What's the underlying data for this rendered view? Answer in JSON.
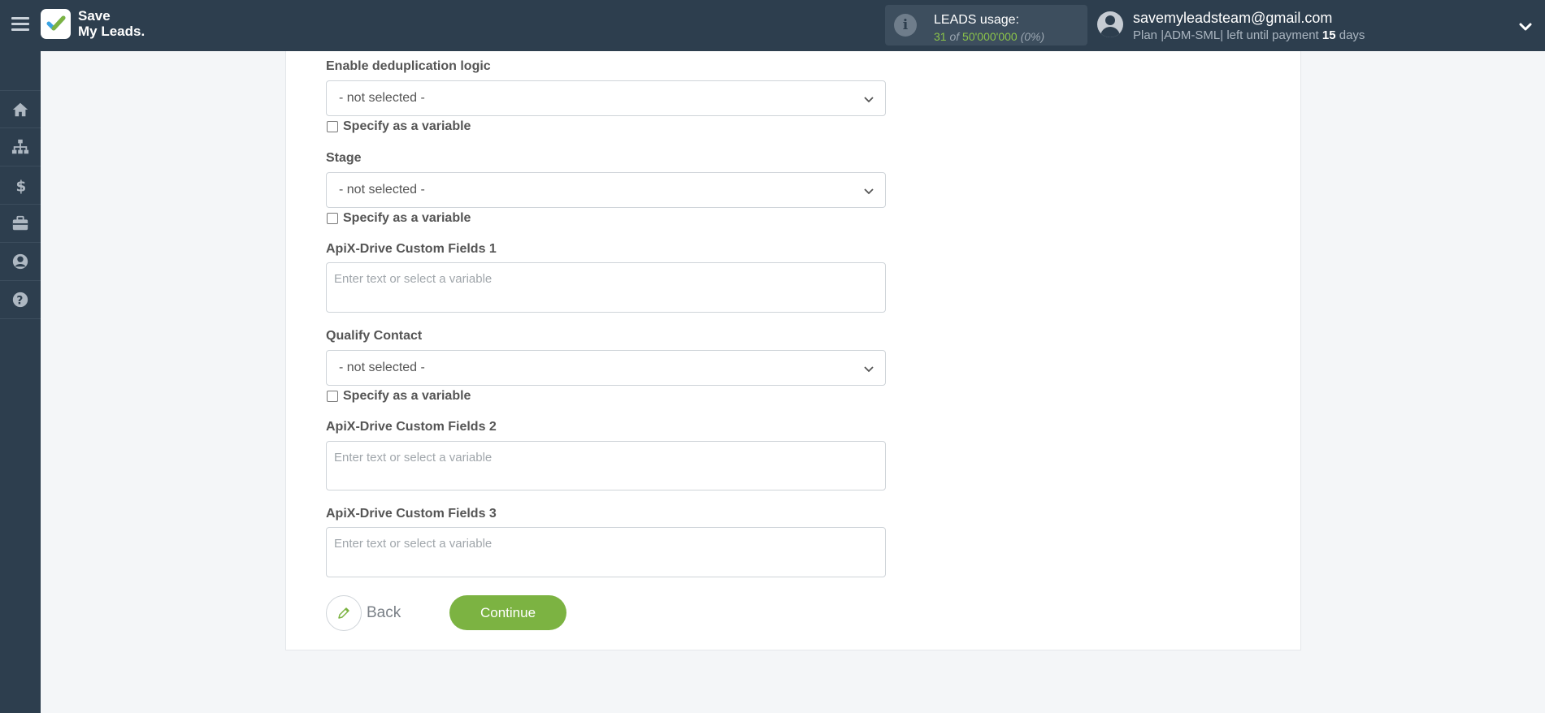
{
  "brand": {
    "line1": "Save",
    "line2": "My Leads",
    "dot": "."
  },
  "usage": {
    "title": "LEADS usage:",
    "used": "31",
    "of": "of",
    "limit": "50'000'000",
    "percent": "(0%)"
  },
  "account": {
    "email": "savemyleadsteam@gmail.com",
    "plan_prefix": "Plan |ADM-SML| left until payment",
    "days_num": "15",
    "days_word": "days"
  },
  "sidebar": {
    "items": [
      {
        "name": "home-icon"
      },
      {
        "name": "sitemap-icon"
      },
      {
        "name": "dollar-icon"
      },
      {
        "name": "briefcase-icon"
      },
      {
        "name": "user-circle-icon"
      },
      {
        "name": "question-circle-icon"
      }
    ]
  },
  "form": {
    "dedup": {
      "label": "Enable deduplication logic",
      "value": "- not selected -",
      "variable_label": "Specify as a variable"
    },
    "stage": {
      "label": "Stage",
      "value": "- not selected -",
      "variable_label": "Specify as a variable"
    },
    "custom1": {
      "label": "ApiX-Drive Custom Fields 1",
      "placeholder": "Enter text or select a variable"
    },
    "qualify": {
      "label": "Qualify Contact",
      "value": "- not selected -",
      "variable_label": "Specify as a variable"
    },
    "custom2": {
      "label": "ApiX-Drive Custom Fields 2",
      "placeholder": "Enter text or select a variable"
    },
    "custom3": {
      "label": "ApiX-Drive Custom Fields 3",
      "placeholder": "Enter text or select a variable"
    }
  },
  "actions": {
    "back": "Back",
    "continue": "Continue"
  },
  "colors": {
    "topbar": "#2d3e4e",
    "accent": "#7cb342",
    "usage_green": "#8bc34a"
  }
}
